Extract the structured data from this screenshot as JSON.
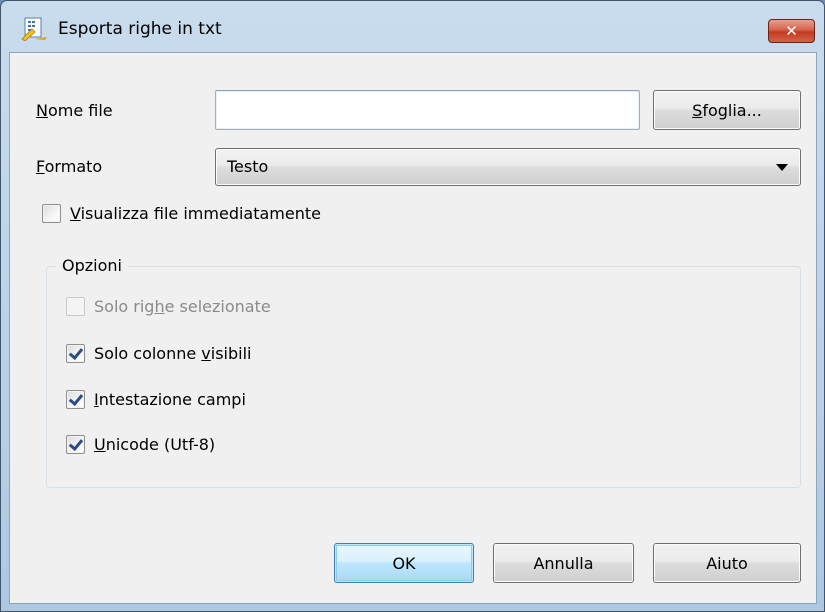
{
  "window": {
    "title": "Esporta righe in txt",
    "icon": "export-doc-icon",
    "close_glyph": "✕"
  },
  "form": {
    "filename": {
      "label_accel": "N",
      "label_rest": "ome file",
      "value": "",
      "browse_accel": "S",
      "browse_rest": "foglia..."
    },
    "format": {
      "label_accel": "F",
      "label_rest": "ormato",
      "selected": "Testo"
    },
    "view_immediately": {
      "accel": "V",
      "rest": "isualizza file immediatamente",
      "checked": false
    }
  },
  "options": {
    "title": "Opzioni",
    "selected_rows": {
      "pre": "Solo rig",
      "accel": "h",
      "post": "e selezionate",
      "checked": false,
      "enabled": false
    },
    "visible_columns": {
      "pre": "Solo colonne ",
      "accel": "v",
      "post": "isibili",
      "checked": true
    },
    "field_header": {
      "pre": "",
      "accel": "I",
      "post": "ntestazione campi",
      "checked": true
    },
    "unicode": {
      "pre": "",
      "accel": "U",
      "post": "nicode (Utf-8)",
      "checked": true
    }
  },
  "buttons": {
    "ok": "OK",
    "cancel": "Annulla",
    "help": "Aiuto"
  }
}
